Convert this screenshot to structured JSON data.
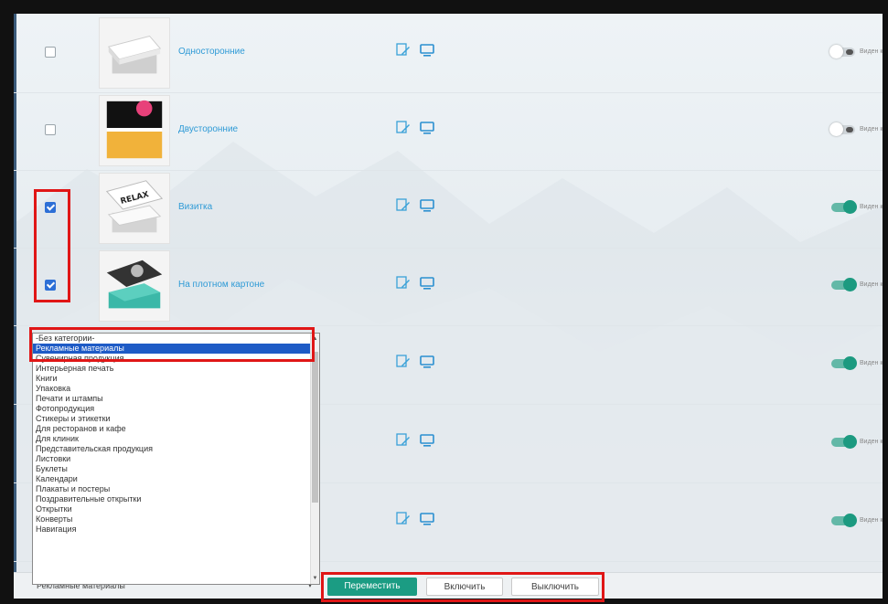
{
  "products": [
    {
      "name": "Односторонние",
      "checked": false,
      "visible": false
    },
    {
      "name": "Двусторонние",
      "checked": false,
      "visible": false
    },
    {
      "name": "Визитка",
      "checked": true,
      "visible": true
    },
    {
      "name": "На плотном картоне",
      "checked": true,
      "visible": true
    },
    {
      "name": "",
      "checked": false,
      "visible": true
    },
    {
      "name": "",
      "checked": false,
      "visible": true
    },
    {
      "name": "",
      "checked": false,
      "visible": true
    }
  ],
  "visibility_label": "Виден к",
  "thumbnail_texts": {
    "relax": "RELAX LIFE RENEW"
  },
  "category_list": {
    "options": [
      "-Без категории-",
      "Рекламные материалы",
      "Сувенирная продукция",
      "Интерьерная печать",
      "Книги",
      "Упаковка",
      "Печати и штампы",
      "Фотопродукция",
      "Стикеры и этикетки",
      "Для ресторанов и кафе",
      "Для клиник",
      "Представительская продукция",
      "Листовки",
      "Буклеты",
      "Календари",
      "Плакаты и постеры",
      "Поздравительные открытки",
      "Открытки",
      "Конверты",
      "Навигация"
    ],
    "selected": "Рекламные материалы"
  },
  "bottom": {
    "select_value": "Рекламные материалы",
    "move_label": "Переместить",
    "enable_label": "Включить",
    "disable_label": "Выключить"
  },
  "colors": {
    "accent": "#1b9c83",
    "link": "#2e9ad6",
    "highlight": "#e01616",
    "selection": "#1e5bc6"
  },
  "icons": [
    "edit-icon",
    "desktop-icon"
  ]
}
